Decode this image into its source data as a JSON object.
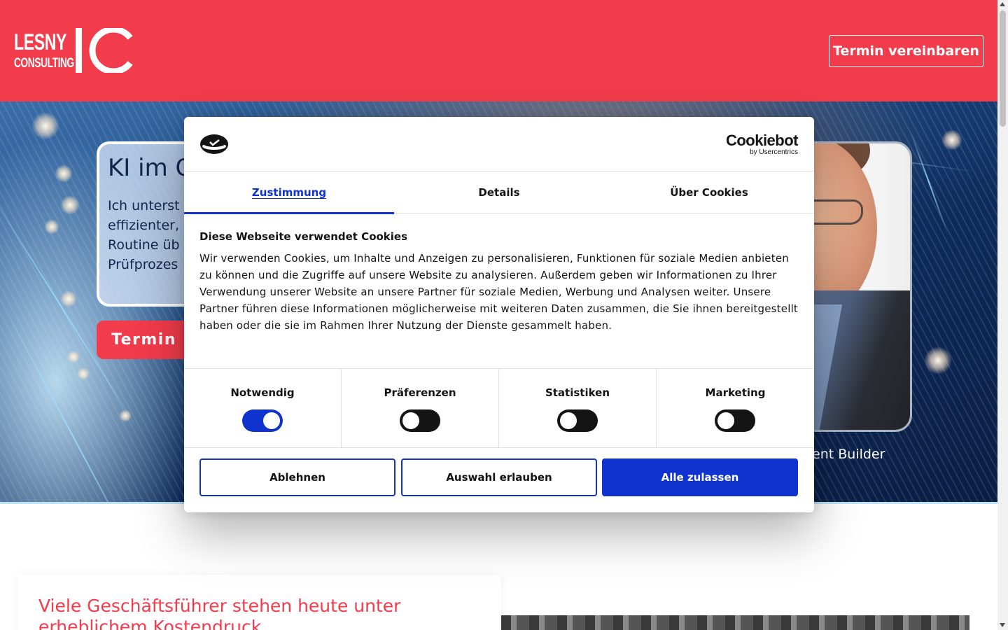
{
  "header": {
    "logo_line1": "LESNY",
    "logo_line2": "CONSULTING",
    "cta_label": "Termin vereinbaren",
    "background_color": "#f23b4b"
  },
  "hero": {
    "title": "KI im G",
    "text_lines": [
      "Ich unterst",
      "effizienter,",
      "Routine üb",
      "Prüfprozes"
    ],
    "button_label": "Termin",
    "caption": "ent Builder"
  },
  "section": {
    "heading": "Viele Geschäftsführer stehen heute unter erheblichem Kostendruck"
  },
  "cookie_dialog": {
    "brand_name": "Cookiebot",
    "brand_sub": "by Usercentrics",
    "tabs": [
      {
        "label": "Zustimmung",
        "active": true
      },
      {
        "label": "Details",
        "active": false
      },
      {
        "label": "Über Cookies",
        "active": false
      }
    ],
    "heading": "Diese Webseite verwendet Cookies",
    "body": "Wir verwenden Cookies, um Inhalte und Anzeigen zu personalisieren, Funktionen für soziale Medien anbieten zu können und die Zugriffe auf unsere Website zu analysieren. Außerdem geben wir Informationen zu Ihrer Verwendung unserer Website an unsere Partner für soziale Medien, Werbung und Analysen weiter. Unsere Partner führen diese Informationen möglicherweise mit weiteren Daten zusammen, die Sie ihnen bereitgestellt haben oder die sie im Rahmen Ihrer Nutzung der Dienste gesammelt haben.",
    "toggles": [
      {
        "label": "Notwendig",
        "on": true
      },
      {
        "label": "Präferenzen",
        "on": false
      },
      {
        "label": "Statistiken",
        "on": false
      },
      {
        "label": "Marketing",
        "on": false
      }
    ],
    "buttons": {
      "decline": "Ablehnen",
      "allow_selection": "Auswahl erlauben",
      "allow_all": "Alle zulassen"
    },
    "accent_color": "#1032cf"
  }
}
